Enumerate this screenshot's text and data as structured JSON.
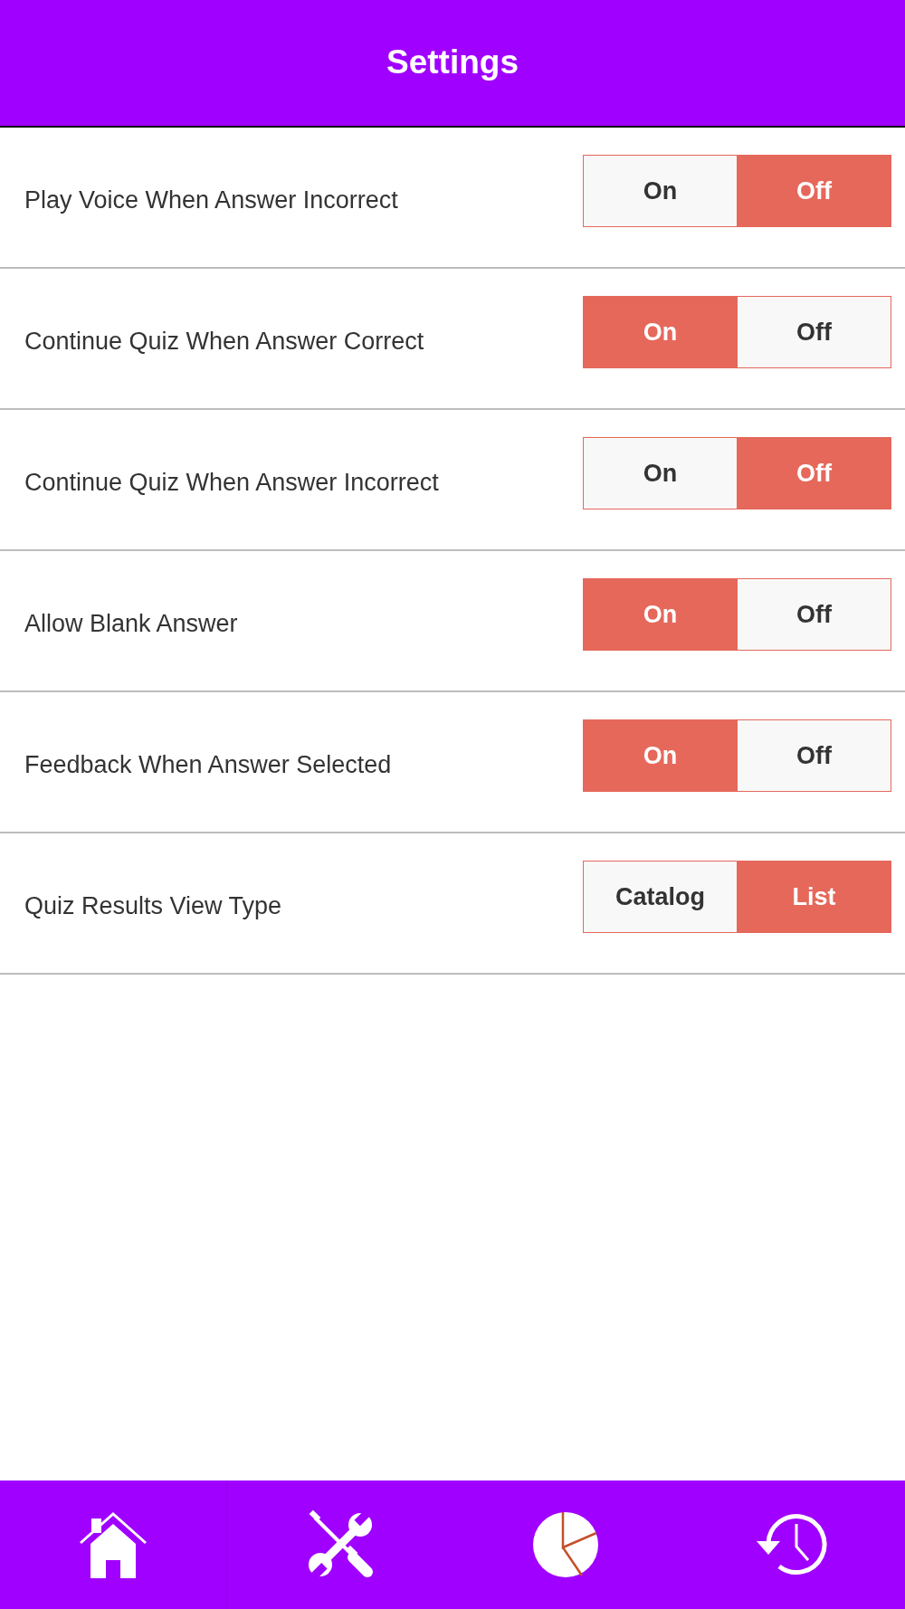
{
  "header": {
    "title": "Settings"
  },
  "settings": [
    {
      "label": "Play Voice When Answer Incorrect",
      "options": [
        {
          "label": "On",
          "selected": false
        },
        {
          "label": "Off",
          "selected": true
        }
      ]
    },
    {
      "label": "Continue Quiz When Answer Correct",
      "options": [
        {
          "label": "On",
          "selected": true
        },
        {
          "label": "Off",
          "selected": false
        }
      ]
    },
    {
      "label": "Continue Quiz When Answer Incorrect",
      "options": [
        {
          "label": "On",
          "selected": false
        },
        {
          "label": "Off",
          "selected": true
        }
      ]
    },
    {
      "label": "Allow Blank Answer",
      "options": [
        {
          "label": "On",
          "selected": true
        },
        {
          "label": "Off",
          "selected": false
        }
      ]
    },
    {
      "label": "Feedback When Answer Selected",
      "options": [
        {
          "label": "On",
          "selected": true
        },
        {
          "label": "Off",
          "selected": false
        }
      ]
    },
    {
      "label": "Quiz Results View Type",
      "options": [
        {
          "label": "Catalog",
          "selected": false
        },
        {
          "label": "List",
          "selected": true
        }
      ]
    }
  ]
}
